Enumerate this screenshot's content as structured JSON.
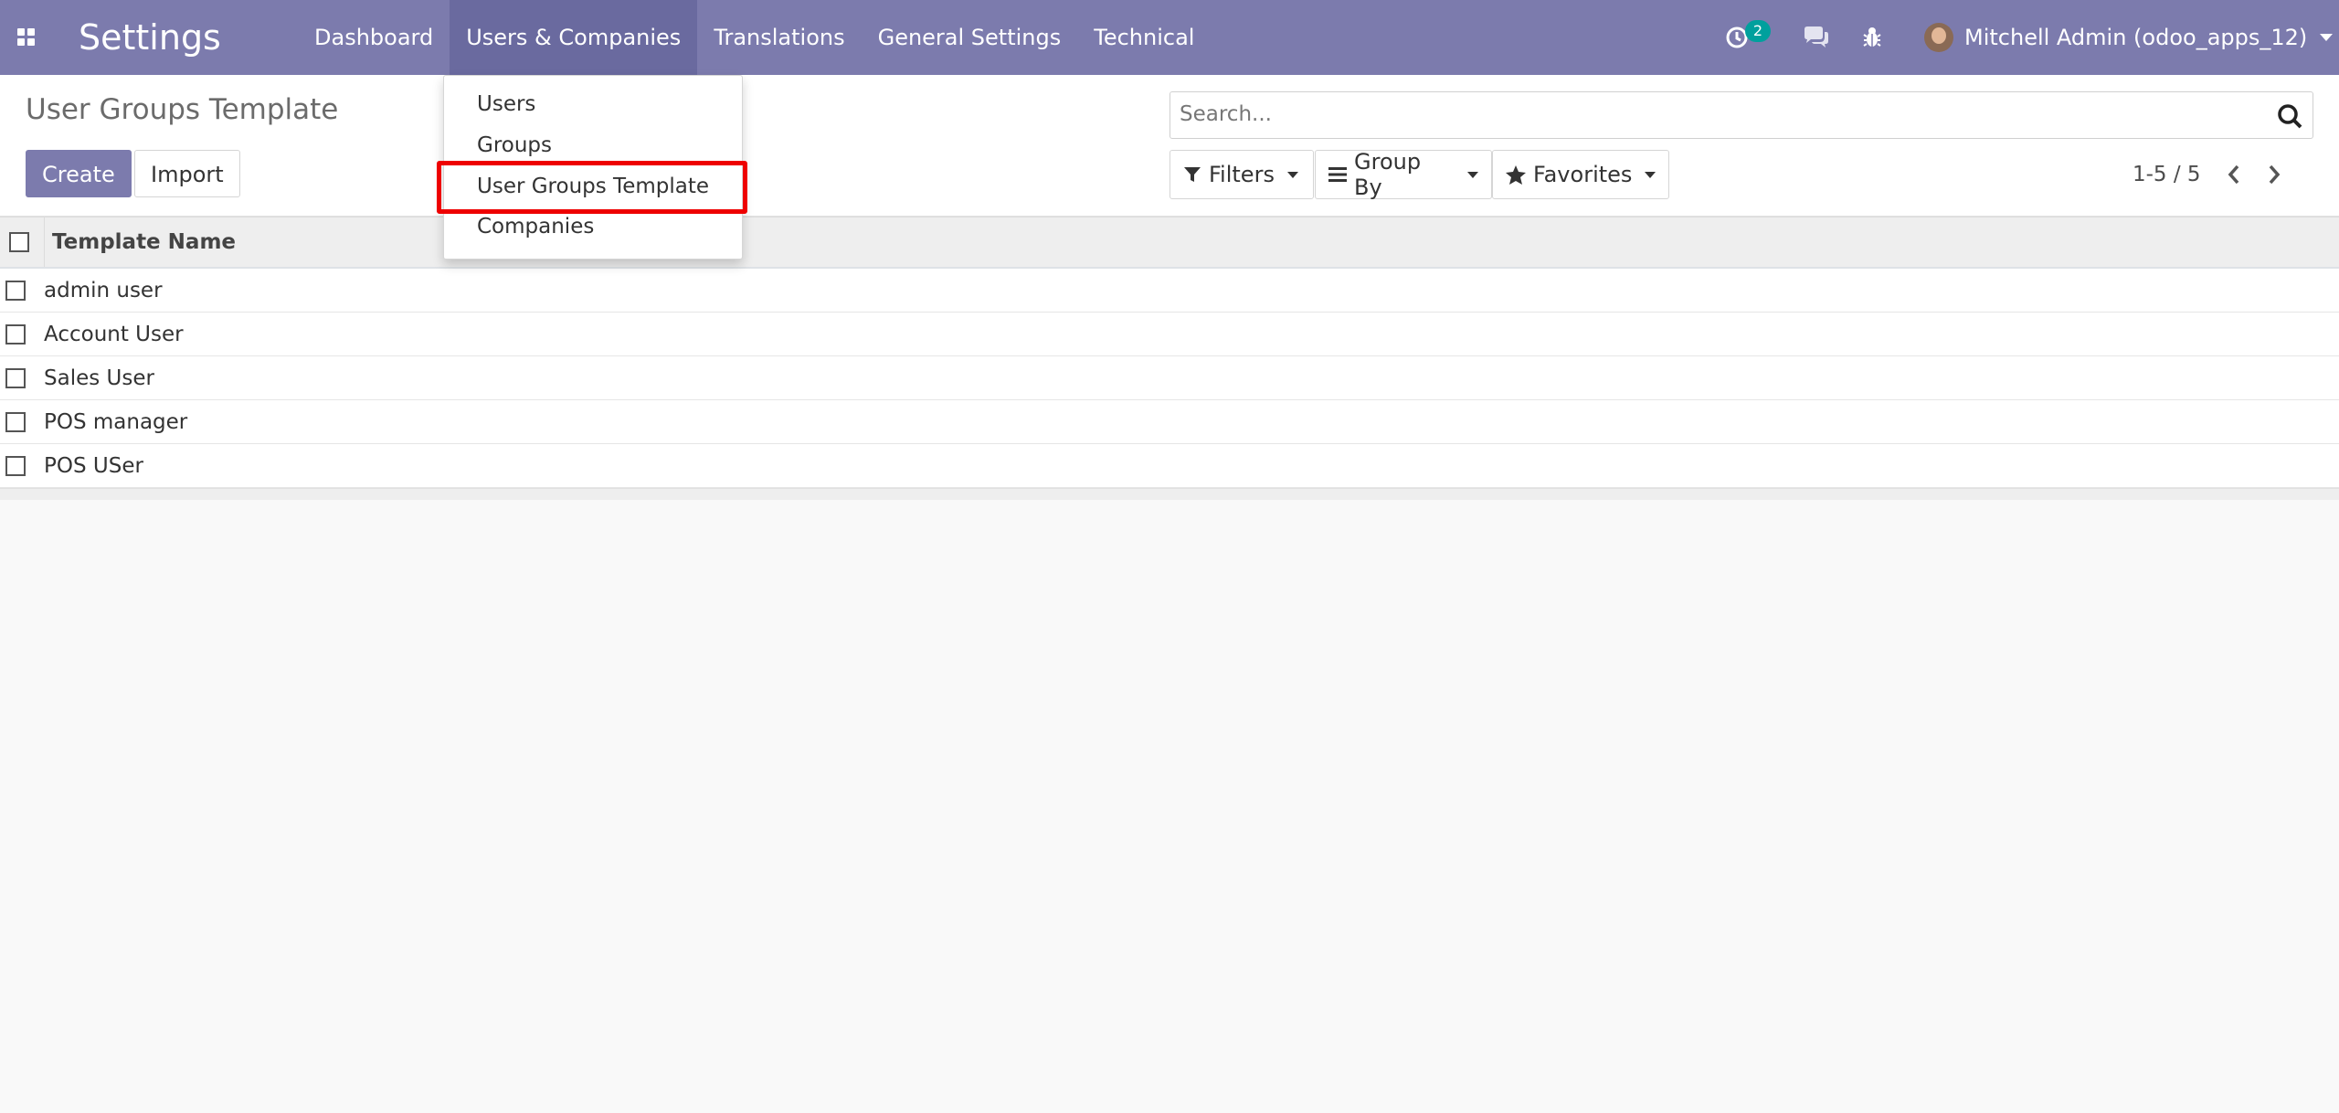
{
  "navbar": {
    "app_title": "Settings",
    "menu": [
      "Dashboard",
      "Users & Companies",
      "Translations",
      "General Settings",
      "Technical"
    ],
    "activity_count": "2",
    "user_name": "Mitchell Admin (odoo_apps_12)",
    "color": "#7c7bad",
    "icons": [
      "apps-grid-icon",
      "activity-clock-icon",
      "chat-icon",
      "debug-bug-icon"
    ]
  },
  "dropdown": {
    "items": [
      "Users",
      "Groups",
      "User Groups Template",
      "Companies"
    ],
    "highlighted": "User Groups Template",
    "highlight_color": "#ee0000"
  },
  "control_panel": {
    "breadcrumb": "User Groups Template",
    "create_label": "Create",
    "import_label": "Import",
    "search_placeholder": "Search...",
    "filters_label": "Filters",
    "groupby_label": "Group By",
    "favorites_label": "Favorites",
    "pager": "1-5 / 5"
  },
  "list": {
    "column": "Template Name",
    "rows": [
      "admin user",
      "Account User",
      "Sales User",
      "POS manager",
      "POS USer"
    ]
  }
}
